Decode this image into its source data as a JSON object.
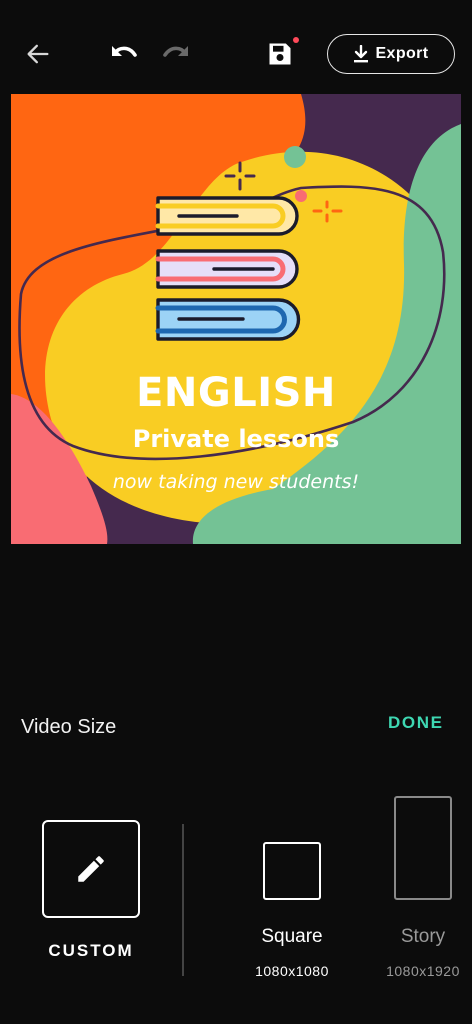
{
  "toolbar": {
    "back_icon": "arrow-left-icon",
    "undo_icon": "undo-icon",
    "redo_icon": "redo-icon",
    "redo_enabled": false,
    "save_icon": "floppy-disk-icon",
    "save_unsaved_indicator": true,
    "export_icon": "download-icon",
    "export_label": "Export"
  },
  "poster": {
    "title": "ENGLISH",
    "subtitle": "Private lessons",
    "tagline": "now taking new students!",
    "illustration": "stack-of-books-icon",
    "colors": {
      "orange": "#ff6612",
      "yellow": "#f9cd23",
      "purple": "#45294e",
      "green": "#74c295",
      "pink": "#f96c73"
    }
  },
  "size_panel": {
    "label": "Video Size",
    "done_label": "DONE",
    "accent_color": "#3ed7b2",
    "options": [
      {
        "id": "custom",
        "label": "CUSTOM",
        "dimensions": "",
        "icon": "pencil-icon",
        "selected": true
      },
      {
        "id": "square",
        "label": "Square",
        "dimensions": "1080x1080",
        "selected": false
      },
      {
        "id": "story",
        "label": "Story",
        "dimensions": "1080x1920",
        "selected": false
      }
    ]
  }
}
